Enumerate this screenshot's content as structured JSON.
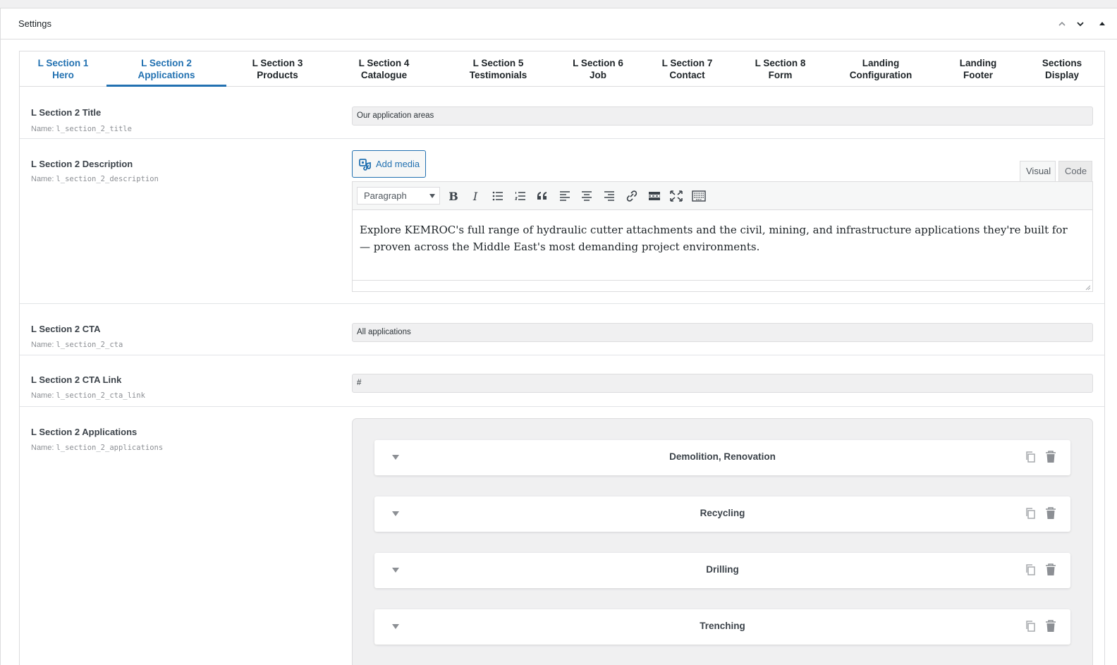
{
  "panel": {
    "title": "Settings"
  },
  "tabs": [
    {
      "line1": "L Section 1",
      "line2": "Hero"
    },
    {
      "line1": "L Section 2",
      "line2": "Applications"
    },
    {
      "line1": "L Section 3",
      "line2": "Products"
    },
    {
      "line1": "L Section 4",
      "line2": "Catalogue"
    },
    {
      "line1": "L Section 5",
      "line2": "Testimonials"
    },
    {
      "line1": "L Section 6",
      "line2": "Job"
    },
    {
      "line1": "L Section 7",
      "line2": "Contact"
    },
    {
      "line1": "L Section 8",
      "line2": "Form"
    },
    {
      "line1": "Landing",
      "line2": "Configuration"
    },
    {
      "line1": "Landing",
      "line2": "Footer"
    },
    {
      "line1": "Sections",
      "line2": "Display"
    }
  ],
  "fields": {
    "title": {
      "label": "L Section 2 Title",
      "name_prefix": "Name:",
      "name": "l_section_2_title",
      "value": "Our application areas"
    },
    "description": {
      "label": "L Section 2 Description",
      "name_prefix": "Name:",
      "name": "l_section_2_description"
    },
    "cta": {
      "label": "L Section 2 CTA",
      "name_prefix": "Name:",
      "name": "l_section_2_cta",
      "value": "All applications"
    },
    "cta_link": {
      "label": "L Section 2 CTA Link",
      "name_prefix": "Name:",
      "name": "l_section_2_cta_link",
      "value": "#"
    },
    "applications": {
      "label": "L Section 2 Applications",
      "name_prefix": "Name:",
      "name": "l_section_2_applications"
    }
  },
  "editor": {
    "add_media": "Add media",
    "visual_tab": "Visual",
    "code_tab": "Code",
    "format_select": "Paragraph",
    "content": "Explore KEMROC's full range of hydraulic cutter attachments and the civil, mining, and infrastructure applications they're built for — proven across the Middle East's most demanding project environments."
  },
  "applications": [
    {
      "title": "Demolition, Renovation"
    },
    {
      "title": "Recycling"
    },
    {
      "title": "Drilling"
    },
    {
      "title": "Trenching"
    }
  ],
  "colors": {
    "accent": "#2271b1",
    "border": "#dcdcde",
    "input_bg": "#f0f0f1"
  }
}
